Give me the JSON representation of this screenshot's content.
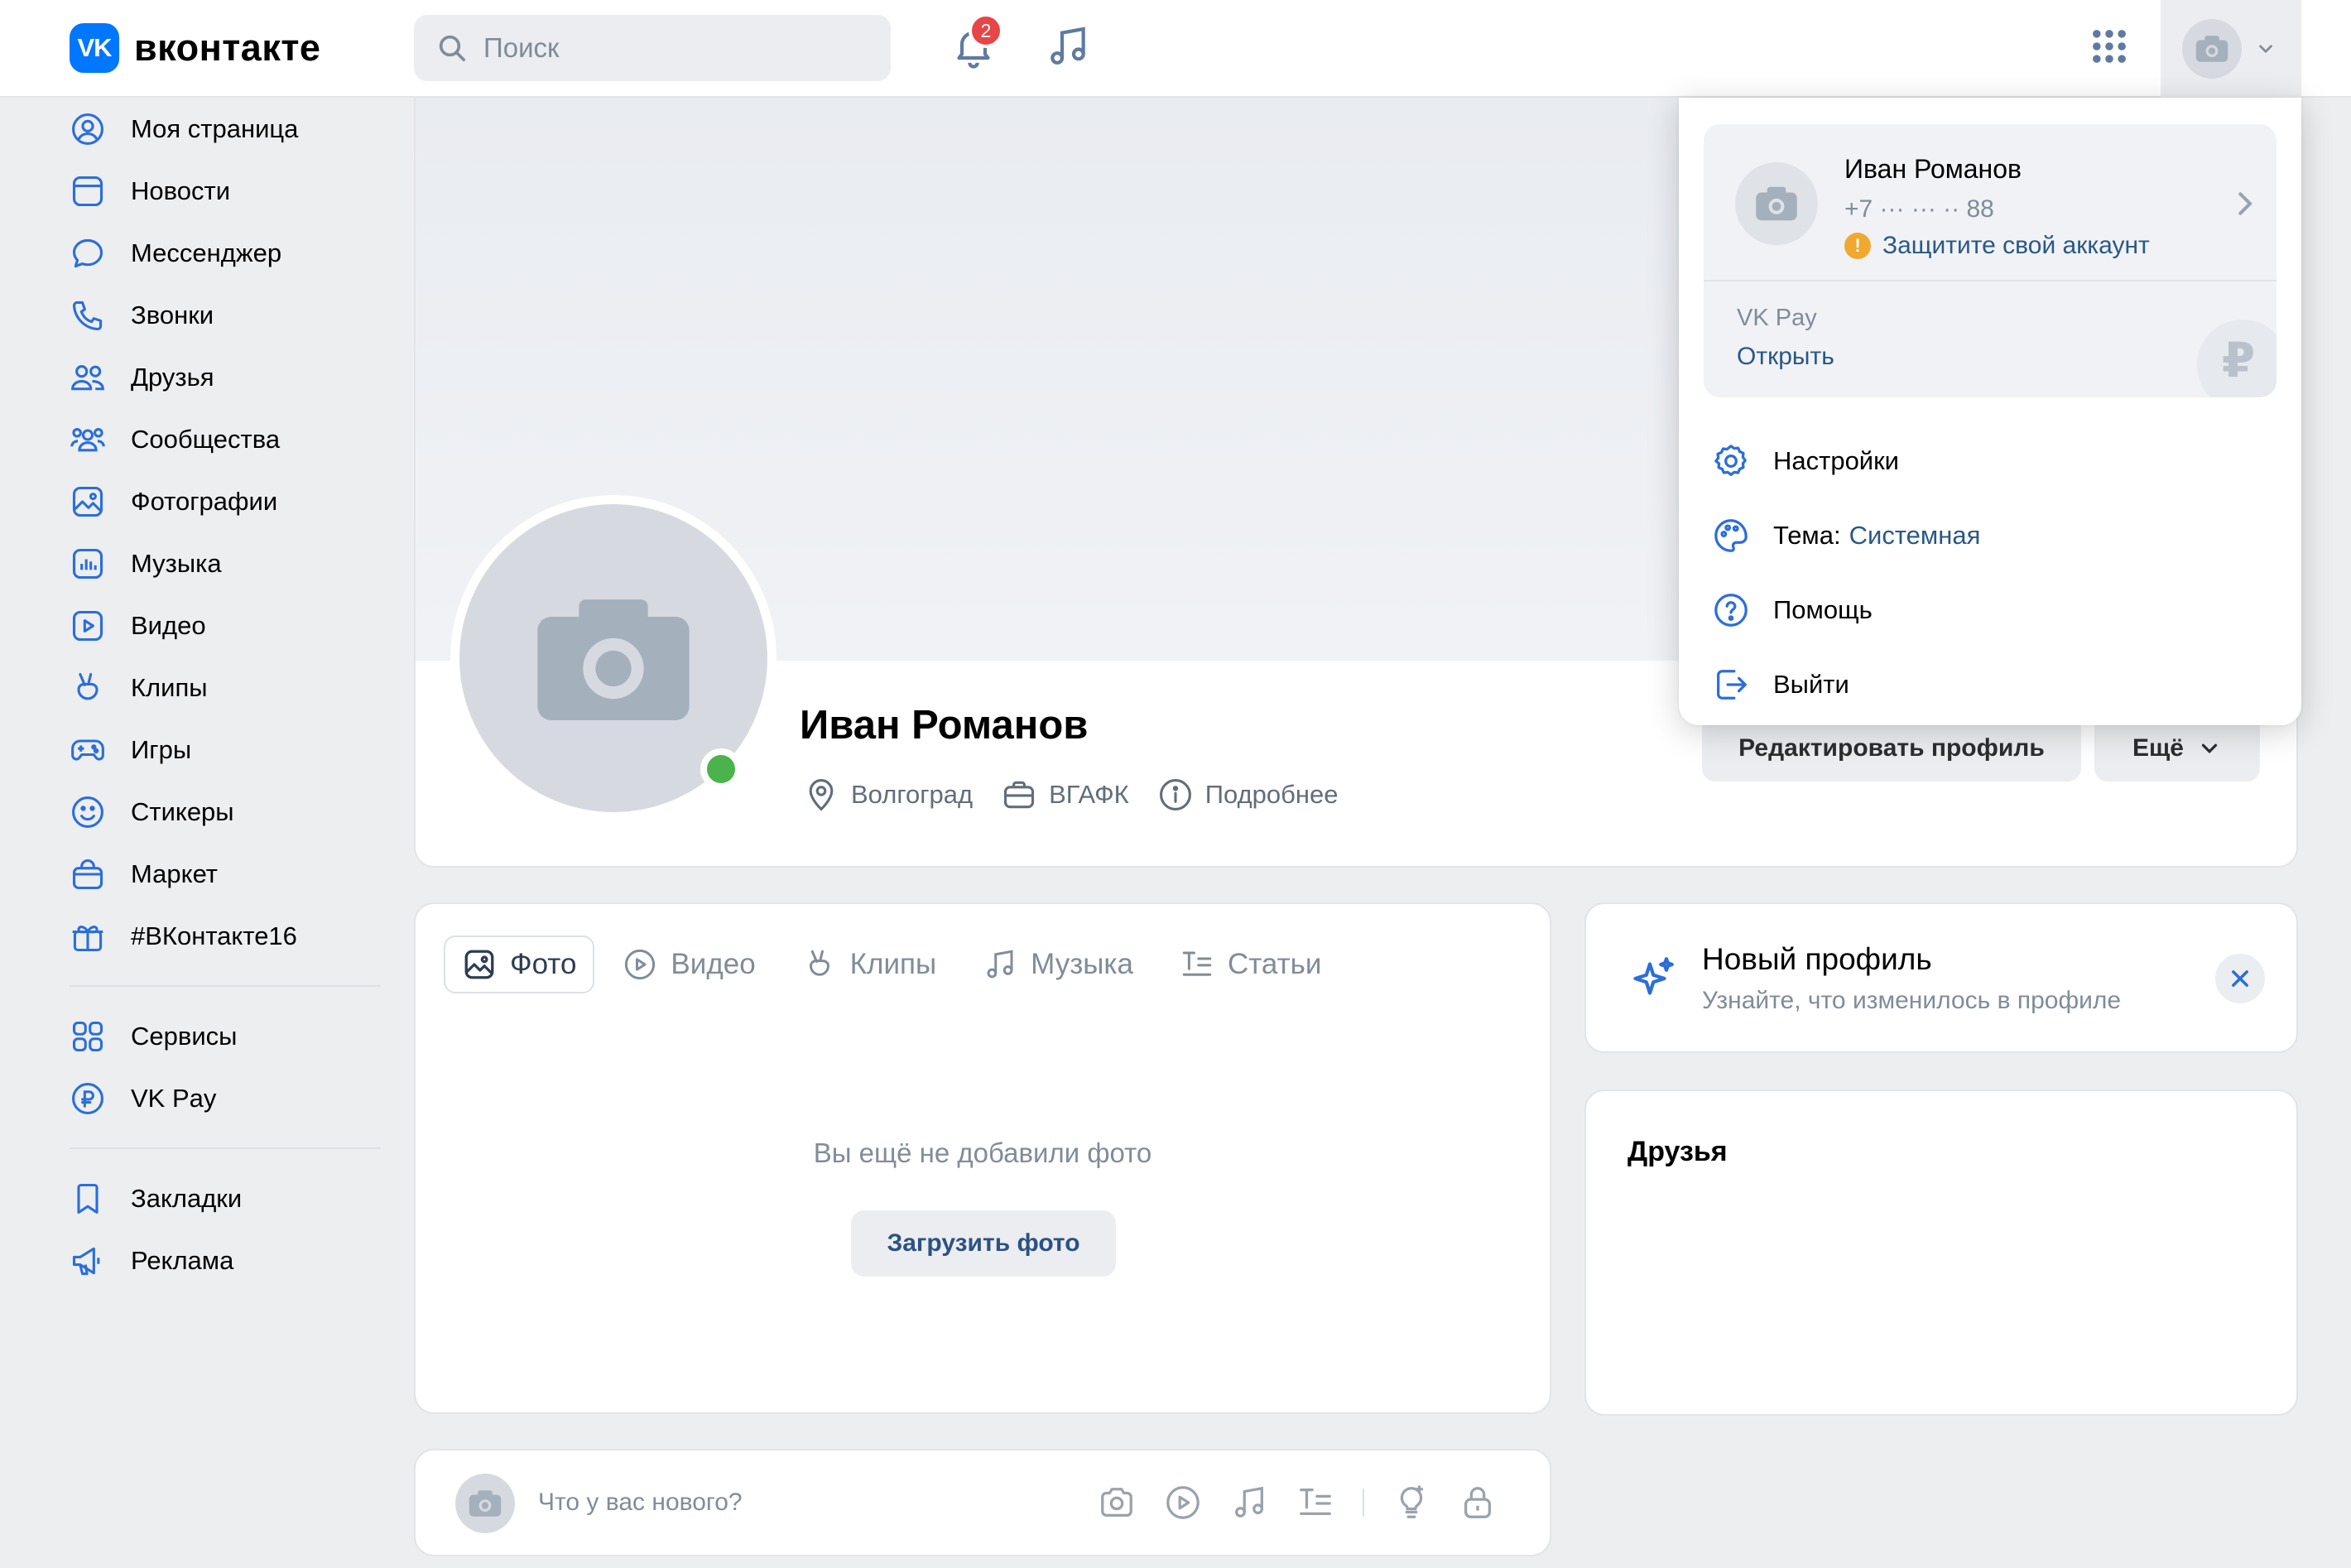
{
  "brand": {
    "logo_mark": "VK",
    "name": "вконтакте"
  },
  "search": {
    "placeholder": "Поиск"
  },
  "notifications": {
    "count": "2"
  },
  "sidebar": {
    "items": [
      {
        "label": "Моя страница",
        "icon": "user-circle-icon"
      },
      {
        "label": "Новости",
        "icon": "news-icon"
      },
      {
        "label": "Мессенджер",
        "icon": "message-icon"
      },
      {
        "label": "Звонки",
        "icon": "phone-icon"
      },
      {
        "label": "Друзья",
        "icon": "friends-icon"
      },
      {
        "label": "Сообщества",
        "icon": "communities-icon"
      },
      {
        "label": "Фотографии",
        "icon": "photo-icon"
      },
      {
        "label": "Музыка",
        "icon": "music-icon"
      },
      {
        "label": "Видео",
        "icon": "video-icon"
      },
      {
        "label": "Клипы",
        "icon": "clips-icon"
      },
      {
        "label": "Игры",
        "icon": "gamepad-icon"
      },
      {
        "label": "Стикеры",
        "icon": "smile-icon"
      },
      {
        "label": "Маркет",
        "icon": "bag-icon"
      },
      {
        "label": "#ВКонтакте16",
        "icon": "gift-icon"
      }
    ],
    "services": [
      {
        "label": "Сервисы",
        "icon": "services-icon"
      },
      {
        "label": "VK Pay",
        "icon": "ruble-icon"
      }
    ],
    "extra": [
      {
        "label": "Закладки",
        "icon": "bookmark-icon"
      },
      {
        "label": "Реклама",
        "icon": "megaphone-icon"
      }
    ]
  },
  "profile": {
    "name": "Иван Романов",
    "city": "Волгоград",
    "work": "ВГАФК",
    "details": "Подробнее",
    "edit_label": "Редактировать профиль",
    "more_label": "Ещё"
  },
  "media_tabs": {
    "tabs": [
      "Фото",
      "Видео",
      "Клипы",
      "Музыка",
      "Статьи"
    ],
    "active": "Фото",
    "empty_text": "Вы ещё не добавили фото",
    "upload_label": "Загрузить фото"
  },
  "new_profile": {
    "title": "Новый профиль",
    "subtitle": "Узнайте, что изменилось в профиле"
  },
  "friends": {
    "title": "Друзья"
  },
  "composer": {
    "placeholder": "Что у вас нового?"
  },
  "dropdown": {
    "account_name": "Иван Романов",
    "phone": "+7 ··· ··· ·· 88",
    "warning": "Защитите свой аккаунт",
    "warning_mark": "!",
    "pay_label": "VK Pay",
    "pay_action": "Открыть",
    "pay_symbol": "₽",
    "settings": "Настройки",
    "theme_label": "Тема:",
    "theme_value": "Системная",
    "help": "Помощь",
    "logout": "Выйти"
  },
  "colors": {
    "accent": "#0077ff",
    "link": "#2a5885",
    "online": "#4bb34b",
    "badge": "#e64646",
    "warning": "#f0a830"
  }
}
